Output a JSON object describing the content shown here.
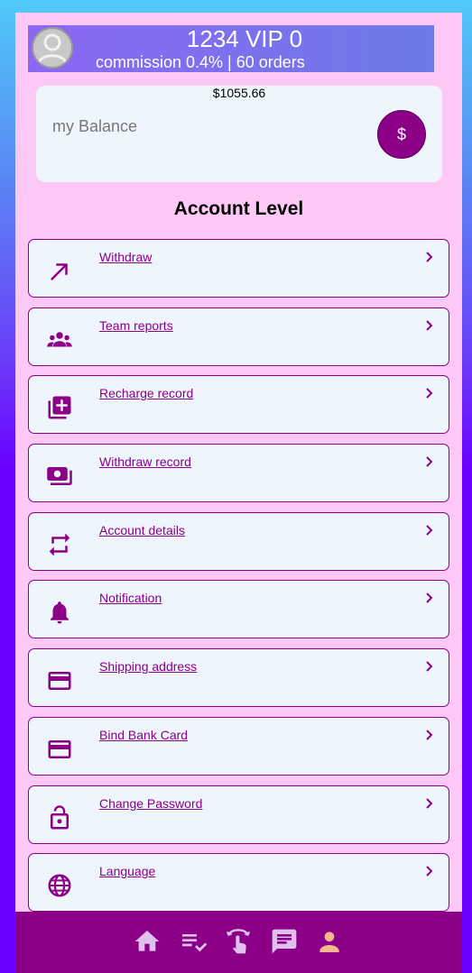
{
  "header": {
    "title": "1234 VIP 0",
    "subtitle": "commission 0.4% | 60 orders"
  },
  "balance": {
    "amount": "$1055.66",
    "label": "my Balance",
    "button_icon": "dollar-icon",
    "button_glyph": "$"
  },
  "section_title": "Account Level",
  "menu": {
    "items": [
      {
        "label": "Withdraw",
        "icon": "arrow-up-right-icon"
      },
      {
        "label": "Team reports",
        "icon": "group-icon"
      },
      {
        "label": "Recharge record",
        "icon": "add-box-icon"
      },
      {
        "label": "Withdraw record",
        "icon": "money-icon"
      },
      {
        "label": "Account details",
        "icon": "repeat-icon"
      },
      {
        "label": "Notification",
        "icon": "bell-icon"
      },
      {
        "label": "Shipping address",
        "icon": "card-icon"
      },
      {
        "label": "Bind Bank Card",
        "icon": "card-icon"
      },
      {
        "label": "Change Password",
        "icon": "unlock-icon"
      },
      {
        "label": "Language",
        "icon": "globe-icon"
      }
    ]
  },
  "nav": {
    "items": [
      {
        "icon": "home-icon"
      },
      {
        "icon": "task-list-icon"
      },
      {
        "icon": "swipe-tap-icon"
      },
      {
        "icon": "chat-icon"
      },
      {
        "icon": "person-icon"
      }
    ]
  },
  "colors": {
    "accent": "#8c0087",
    "page_bg": "#fdc8f6",
    "card_bg": "#eef5fd",
    "nav_icon": "#e0c0ef",
    "nav_icon_active": "#f5b88a"
  }
}
